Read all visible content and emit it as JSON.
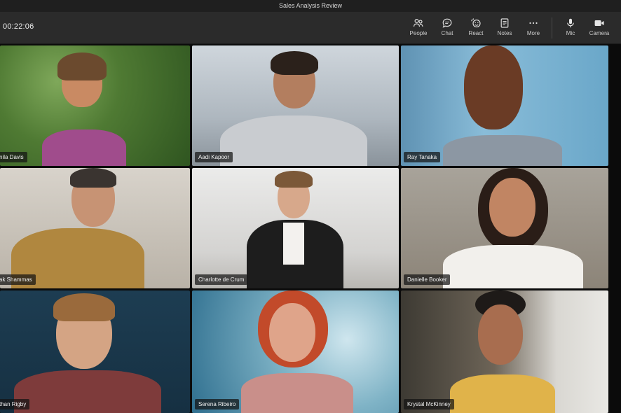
{
  "window": {
    "title": "Sales Analysis Review"
  },
  "toolbar": {
    "timer": "00:22:06",
    "buttons": [
      {
        "label": "People",
        "icon": "people-icon"
      },
      {
        "label": "Chat",
        "icon": "chat-icon"
      },
      {
        "label": "React",
        "icon": "react-icon"
      },
      {
        "label": "Notes",
        "icon": "notes-icon"
      },
      {
        "label": "More",
        "icon": "more-icon"
      },
      {
        "label": "Mic",
        "icon": "mic-icon"
      },
      {
        "label": "Camera",
        "icon": "camera-icon"
      }
    ]
  },
  "participants": [
    {
      "name": "nila Davis",
      "kind": "avatar"
    },
    {
      "name": "Aadi Kapoor",
      "kind": "video"
    },
    {
      "name": "Ray Tanaka",
      "kind": "avatar"
    },
    {
      "name": "ak Shammas",
      "kind": "video"
    },
    {
      "name": "Charlotte de Crum",
      "kind": "video"
    },
    {
      "name": "Danielle Booker",
      "kind": "video"
    },
    {
      "name": "than Rigby",
      "kind": "video"
    },
    {
      "name": "Serena Ribeiro",
      "kind": "avatar"
    },
    {
      "name": "Krystal McKinney",
      "kind": "avatar"
    }
  ],
  "colors": {
    "toolbar_bg": "#2b2b2b",
    "titlebar_bg": "#1f1f1f",
    "stage_bg": "#0b0b0b"
  }
}
